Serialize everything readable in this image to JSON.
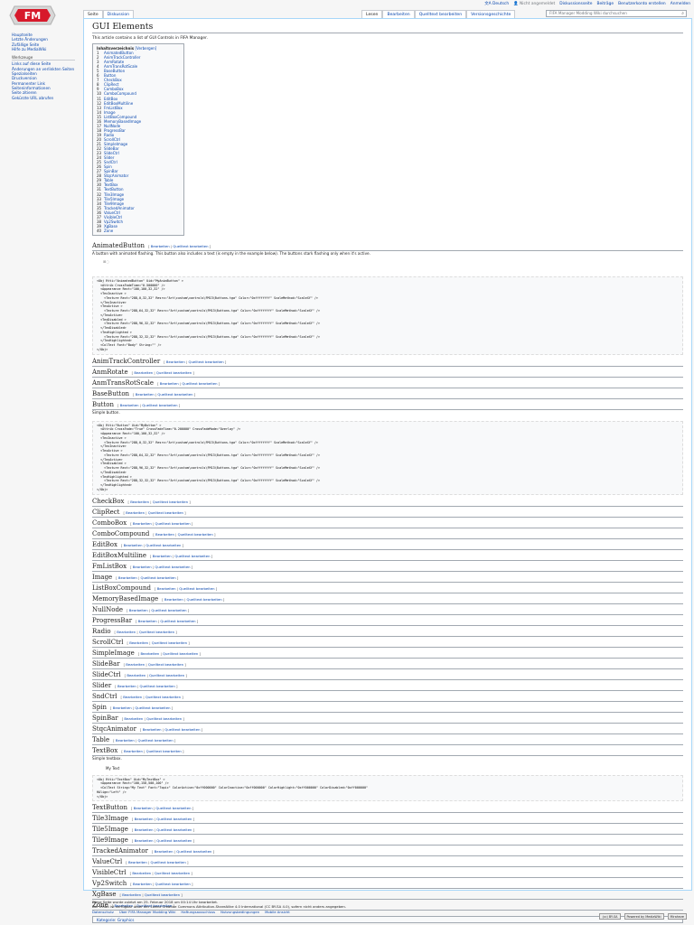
{
  "logo_text": "FM",
  "top_links": {
    "language": "Deutsch",
    "not_logged_in": "Nicht angemeldet",
    "talk": "Diskussionsseite",
    "contributions": "Beiträge",
    "create_account": "Benutzerkonto erstellen",
    "login": "Anmelden"
  },
  "tabs": {
    "page": "Seite",
    "discussion": "Diskussion",
    "read": "Lesen",
    "edit": "Bearbeiten",
    "edit_source": "Quelltext bearbeiten",
    "history": "Versionsgeschichte"
  },
  "search": {
    "placeholder": "FIFA Manager Modding Wiki durchsuchen"
  },
  "sidebar": {
    "nav": [
      "Hauptseite",
      "Letzte Änderungen",
      "Zufällige Seite",
      "Hilfe zu MediaWiki"
    ],
    "tools_heading": "Werkzeuge",
    "tools": [
      "Links auf diese Seite",
      "Änderungen an verlinkten Seiten",
      "Spezialseiten",
      "Druckversion",
      "Permanenter Link",
      "Seiteninformationen",
      "Seite zitieren",
      "Gekürzte URL abrufen"
    ]
  },
  "page": {
    "title": "GUI Elements",
    "intro": "This article contains a list of GUI Controls in FIFA Manager."
  },
  "toc": {
    "title": "Inhaltsverzeichnis",
    "hide": "[Verbergen]",
    "items": [
      "AnimatedButton",
      "AnimTrackController",
      "AnmRotate",
      "AnmTransRotScale",
      "BaseButton",
      "Button",
      "CheckBox",
      "ClipRect",
      "ComboBox",
      "ComboCompound",
      "EditBox",
      "EditBoxMultiline",
      "FmListBox",
      "Image",
      "ListBoxCompound",
      "MemoryBasedImage",
      "NullNode",
      "ProgressBar",
      "Radio",
      "ScrollCtrl",
      "SimpleImage",
      "SlideBar",
      "SlideCtrl",
      "Slider",
      "SndCtrl",
      "Spin",
      "SpinBar",
      "StqcAnimator",
      "Table",
      "TextBox",
      "TextButton",
      "Tile3Image",
      "Tile5Image",
      "Tile9Image",
      "TrackedAnimator",
      "ValueCtrl",
      "VisibleCtrl",
      "Vp2Switch",
      "XgBase",
      "Zone"
    ]
  },
  "edit_links": {
    "edit": "Bearbeiten",
    "edit_source": "Quelltext bearbeiten"
  },
  "animated_desc": "A button with animated flashing. This button also includes a text (is empty in the example below). The buttons stark flashing only when it's active.",
  "button_desc": "Simple button.",
  "textbox_desc": "Simple textbox.",
  "textbox_sample": "My Text",
  "code_animated": [
    "<Obj Rtti=\"AnimatedButton\" Uid=\"MyAnimButton\" >",
    "  <Attrib CrossFadeTime=\"0.500000\" />",
    "  <Appearance Rect=\"100,100,32,32\" />",
    "  <TexInactive >",
    "    <Texture Rect=\"288,0,32,32\" Resrc=\"Art\\custom\\controls\\FM13\\Buttons.tga\" Color=\"0xffffffff\" ScaleMethod=\"ScaleXY\" />",
    "  </TexInactive>",
    "  <TexActive >",
    "    <Texture Rect=\"288,64,32,32\" Resrc=\"Art\\custom\\controls\\FM13\\Buttons.tga\" Color=\"0xffffffff\" ScaleMethod=\"ScaleXY\" />",
    "  </TexActive>",
    "  <TexDisabled >",
    "    <Texture Rect=\"288,96,32,32\" Resrc=\"Art\\custom\\controls\\FM13\\Buttons.tga\" Color=\"0xffffffff\" ScaleMethod=\"ScaleXY\" />",
    "  </TexDisabled>",
    "  <TexHighlighted >",
    "    <Texture Rect=\"288,32,32,32\" Resrc=\"Art\\custom\\controls\\FM13\\Buttons.tga\" Color=\"0xffffffff\" ScaleMethod=\"ScaleXY\" />",
    "  </TexHighlighted>",
    "  <ColText Font=\"Body\" String=\"\" />",
    "</Obj>"
  ],
  "code_button": [
    "<Obj Rtti=\"Button\" Uid=\"MyButton\" >",
    "  <Attrib CrossFade=\"True\" CrossFadeTime=\"0.200000\" CrossFadeMode=\"Overlay\" />",
    "  <Appearance Rect=\"100,100,32,32\" />",
    "  <TexInactive >",
    "    <Texture Rect=\"288,0,32,32\" Resrc=\"Art\\custom\\controls\\FM13\\Buttons.tga\" Color=\"0xffffffff\" ScaleMethod=\"ScaleXY\" />",
    "  </TexInactive>",
    "  <TexActive >",
    "    <Texture Rect=\"288,64,32,32\" Resrc=\"Art\\custom\\controls\\FM13\\Buttons.tga\" Color=\"0xffffffff\" ScaleMethod=\"ScaleXY\" />",
    "  </TexActive>",
    "  <TexDisabled >",
    "    <Texture Rect=\"288,96,32,32\" Resrc=\"Art\\custom\\controls\\FM13\\Buttons.tga\" Color=\"0xffffffff\" ScaleMethod=\"ScaleXY\" />",
    "  </TexDisabled>",
    "  <TexHighlighted >",
    "    <Texture Rect=\"288,32,32,32\" Resrc=\"Art\\custom\\controls\\FM13\\Buttons.tga\" Color=\"0xffffffff\" ScaleMethod=\"ScaleXY\" />",
    "  </TexHighlighted>",
    "</Obj>"
  ],
  "code_textbox": [
    "<Obj Rtti=\"TextBox\" Uid=\"MyTextBox\" >",
    "  <Appearance Rect=\"100,150,500,100\" />",
    "  <ColText String=\"My Text\" Font=\"Topic\" ColorActive=\"0xff000000\" ColorInactive=\"0xff000000\" ColorHighlight=\"0xff000000\" ColorDisabled=\"0xff000000\"",
    "HAlign=\"Left\" />",
    "</Obj>"
  ],
  "category": {
    "label": "Kategorie",
    "value": "Graphics"
  },
  "footer": {
    "modified": "Diese Seite wurde zuletzt am 25. Februar 2018 um 00:14 Uhr bearbeitet.",
    "license": "Der Inhalt ist verfügbar unter der Lizenz Creative Commons Attribution-ShareAlike 4.0 International (CC BY-SA 4.0), sofern nicht anders angegeben.",
    "links": [
      "Datenschutz",
      "Über FIFA Manager Modding Wiki",
      "Haftungsausschluss",
      "Nutzungsbedingungen",
      "Mobile Ansicht"
    ],
    "badge_cc": "(cc) BY-SA",
    "badge_mw": "Powered by MediaWiki",
    "badge_hosted": "Miraheze"
  }
}
